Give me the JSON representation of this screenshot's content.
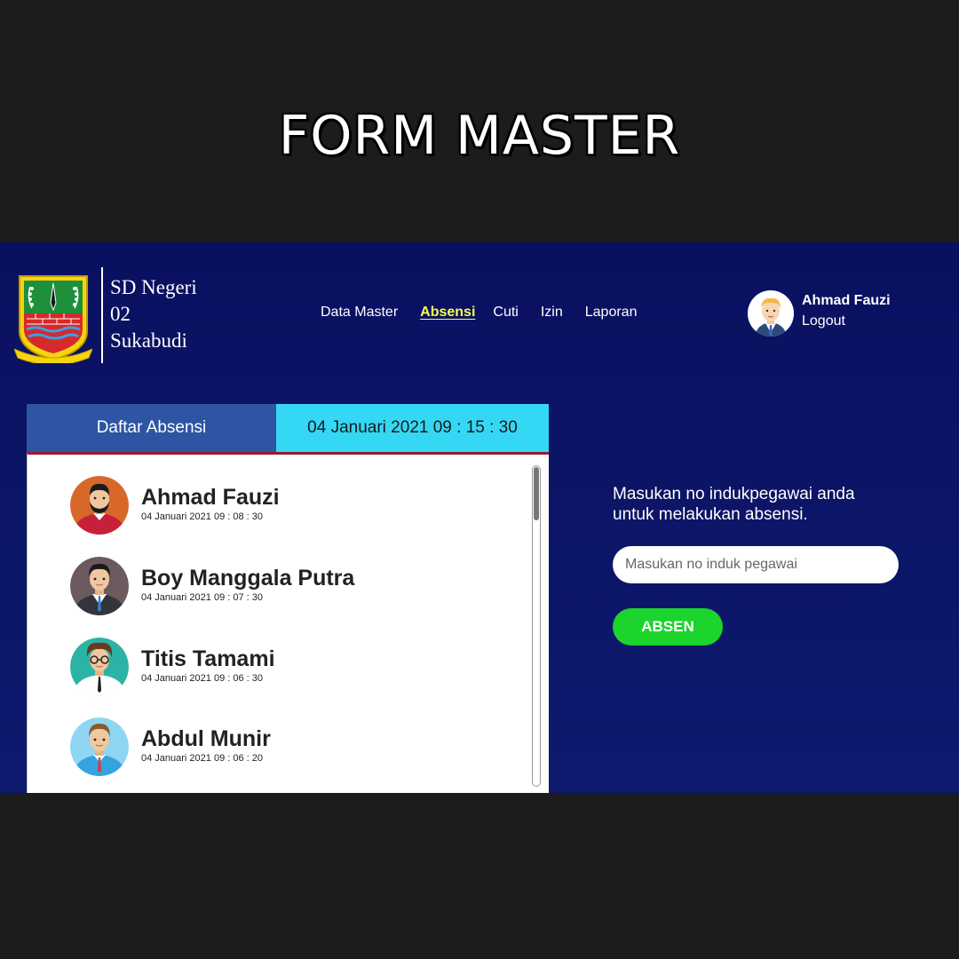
{
  "page_title": "FORM MASTER",
  "brand": {
    "line1": "SD Negeri",
    "line2": "02",
    "line3": "Sukabudi"
  },
  "nav": [
    {
      "label": "Data Master",
      "active": false
    },
    {
      "label": "Absensi",
      "active": true
    },
    {
      "label": "Cuti",
      "active": false
    },
    {
      "label": "Izin",
      "active": false
    },
    {
      "label": "Laporan",
      "active": false
    }
  ],
  "user": {
    "name": "Ahmad Fauzi",
    "logout_label": "Logout",
    "avatar_icon": "user-avatar-icon"
  },
  "panel": {
    "tab_list_label": "Daftar Absensi",
    "clock": "04 Januari 2021 09 : 15 : 30",
    "accent_color": "#9c1a2c",
    "entries": [
      {
        "name": "Ahmad Fauzi",
        "time": "04 Januari 2021 09 : 08 : 30",
        "avatar_icon": "avatar-bearded-man-icon"
      },
      {
        "name": "Boy Manggala Putra",
        "time": "04 Januari 2021 09 : 07 : 30",
        "avatar_icon": "avatar-businessman-icon"
      },
      {
        "name": "Titis Tamami",
        "time": "04 Januari 2021 09 : 06 : 30",
        "avatar_icon": "avatar-glasses-man-icon"
      },
      {
        "name": "Abdul Munir",
        "time": "04 Januari 2021 09 : 06 : 20",
        "avatar_icon": "avatar-young-man-icon"
      }
    ]
  },
  "form": {
    "instruction": "Masukan no indukpegawai anda untuk melakukan absensi.",
    "input_placeholder": "Masukan no induk pegawai",
    "input_value": "",
    "submit_label": "ABSEN",
    "submit_color": "#1bd42c"
  }
}
